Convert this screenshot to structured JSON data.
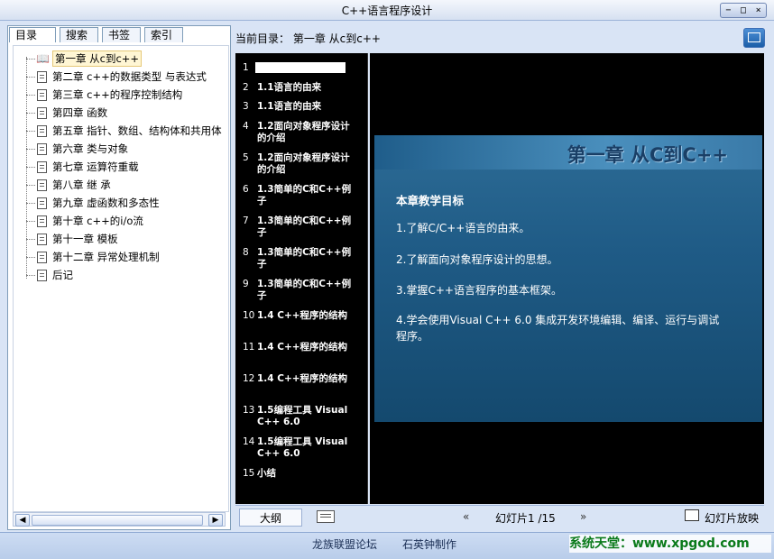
{
  "window": {
    "title": "C++语言程序设计",
    "controls": [
      "−",
      "□",
      "×"
    ]
  },
  "tabs": [
    {
      "label": "目录",
      "active": true
    },
    {
      "label": "搜索",
      "active": false
    },
    {
      "label": "书签",
      "active": false
    },
    {
      "label": "索引",
      "active": false
    }
  ],
  "tree": {
    "items": [
      {
        "label": "第一章 从c到c++",
        "icon": "open-book-icon",
        "selected": true
      },
      {
        "label": "第二章 c++的数据类型 与表达式",
        "icon": "document-icon"
      },
      {
        "label": "第三章 c++的程序控制结构",
        "icon": "document-icon"
      },
      {
        "label": "第四章 函数",
        "icon": "document-icon"
      },
      {
        "label": "第五章 指针、数组、结构体和共用体",
        "icon": "document-icon"
      },
      {
        "label": "第六章 类与对象",
        "icon": "document-icon"
      },
      {
        "label": "第七章 运算符重载",
        "icon": "document-icon"
      },
      {
        "label": "第八章  继 承",
        "icon": "document-icon"
      },
      {
        "label": "第九章 虚函数和多态性",
        "icon": "document-icon"
      },
      {
        "label": "第十章 c++的i/o流",
        "icon": "document-icon"
      },
      {
        "label": "第十一章 模板",
        "icon": "document-icon"
      },
      {
        "label": "第十二章   异常处理机制",
        "icon": "document-icon"
      },
      {
        "label": "后记",
        "icon": "document-icon"
      }
    ]
  },
  "current_dir": "当前目录： 第一章 从c到c++",
  "outline": {
    "items": [
      {
        "num": "1",
        "text": ""
      },
      {
        "num": "2",
        "text": "1.1语言的由来"
      },
      {
        "num": "3",
        "text": "1.1语言的由来"
      },
      {
        "num": "4",
        "text": "1.2面向对象程序设计的介绍"
      },
      {
        "num": "5",
        "text": "1.2面向对象程序设计的介绍"
      },
      {
        "num": "6",
        "text": "1.3简单的C和C++例子"
      },
      {
        "num": "7",
        "text": "1.3简单的C和C++例子"
      },
      {
        "num": "8",
        "text": "1.3简单的C和C++例子"
      },
      {
        "num": "9",
        "text": "1.3简单的C和C++例子"
      },
      {
        "num": "10",
        "text": "1.4 C++程序的结构"
      },
      {
        "num": "11",
        "text": "1.4 C++程序的结构"
      },
      {
        "num": "12",
        "text": "1.4 C++程序的结构"
      },
      {
        "num": "13",
        "text": "1.5编程工具 Visual C++ 6.0"
      },
      {
        "num": "14",
        "text": "1.5编程工具 Visual C++ 6.0"
      },
      {
        "num": "15",
        "text": "小结"
      }
    ]
  },
  "slide": {
    "title": "第一章 从C到C++",
    "goal_heading": "本章教学目标",
    "points": [
      "1.了解C/C++语言的由来。",
      "2.了解面向对象程序设计的思想。",
      "3.掌握C++语言程序的基本框架。",
      "4.学会使用Visual C++ 6.0 集成开发环境编辑、编译、运行与调试程序。"
    ]
  },
  "bottombar": {
    "outline_label": "大纲",
    "prev": "«",
    "slide_count": "幻灯片1 /15",
    "next": "»",
    "slideshow_label": "幻灯片放映"
  },
  "status": {
    "left_text": "龙族联盟论坛",
    "right_text": "石英钟制作",
    "watermark": "系统天堂：www.xpgod.com"
  },
  "colors": {
    "accent": "#1f5b86",
    "slide_title": "#1a3f66",
    "watermark_green": "#0a7a1a"
  }
}
